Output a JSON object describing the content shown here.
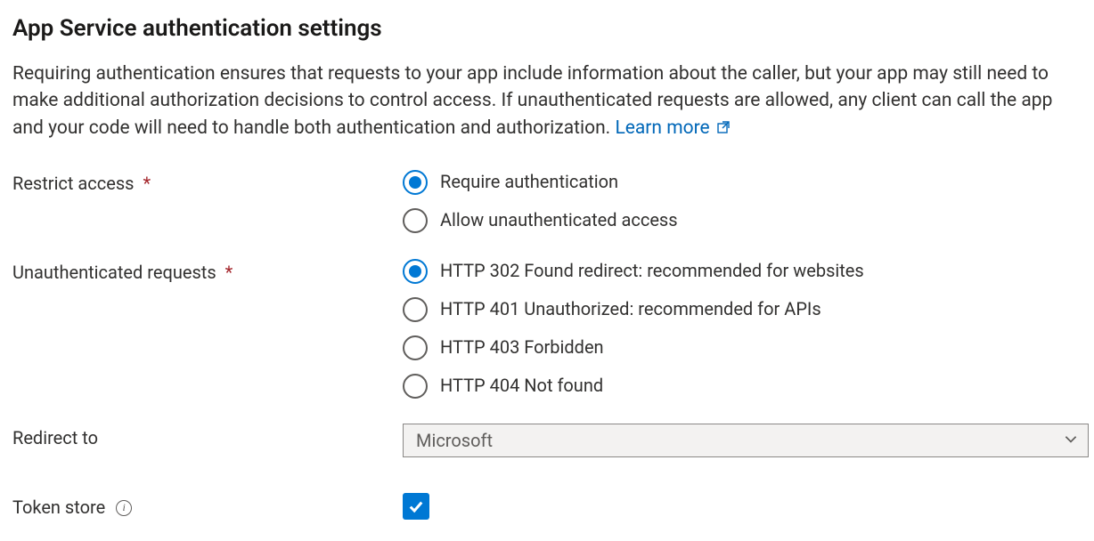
{
  "title": "App Service authentication settings",
  "description": "Requiring authentication ensures that requests to your app include information about the caller, but your app may still need to make additional authorization decisions to control access. If unauthenticated requests are allowed, any client can call the app and your code will need to handle both authentication and authorization. ",
  "learn_more": "Learn more",
  "fields": {
    "restrict_access": {
      "label": "Restrict access",
      "required": true,
      "options": {
        "require": "Require authentication",
        "allow": "Allow unauthenticated access"
      },
      "selected": "require"
    },
    "unauth_requests": {
      "label": "Unauthenticated requests",
      "required": true,
      "options": {
        "http302": "HTTP 302 Found redirect: recommended for websites",
        "http401": "HTTP 401 Unauthorized: recommended for APIs",
        "http403": "HTTP 403 Forbidden",
        "http404": "HTTP 404 Not found"
      },
      "selected": "http302"
    },
    "redirect_to": {
      "label": "Redirect to",
      "value": "Microsoft"
    },
    "token_store": {
      "label": "Token store",
      "checked": true
    }
  }
}
